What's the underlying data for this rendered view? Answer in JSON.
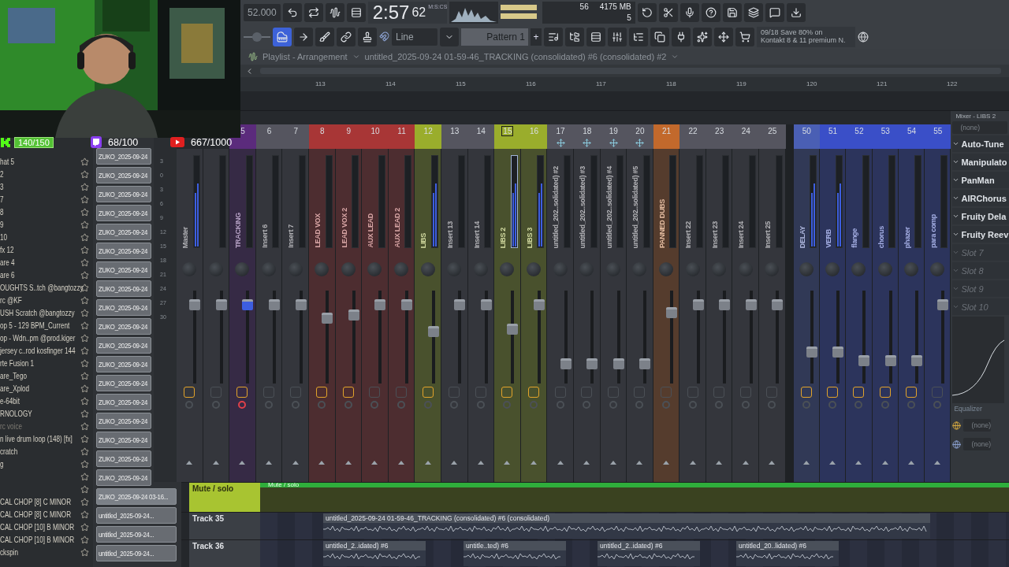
{
  "overlay": {
    "counters": [
      {
        "kind": "kick",
        "value": "140/150"
      },
      {
        "kind": "twitch",
        "value": "68/100"
      },
      {
        "kind": "youtube",
        "value": "667/1000"
      }
    ]
  },
  "toolbar": {
    "tempo": "52.000",
    "time": {
      "main": "2:57",
      "frac": "62",
      "unit": "M:S:CS"
    },
    "cpu": "56",
    "memory": "4175 MB",
    "voices": "5",
    "snap": "Line",
    "pattern": "Pattern 1",
    "pattern_add": "+",
    "news": {
      "date": "09/18",
      "line1": "Save 80% on",
      "line2": "Kontakt 8 & 11 premium N."
    },
    "tools": [
      {
        "selected": true
      },
      {
        "selected": false
      },
      {
        "selected": false
      },
      {
        "selected": false
      },
      {
        "selected": false
      }
    ]
  },
  "playlist": {
    "title": "Playlist - Arrangement",
    "arrangement": "untitled_2025-09-24 01-59-46_TRACKING (consolidated) #6 (consolidated) #2",
    "ruler": [
      "113",
      "114",
      "115",
      "116",
      "117",
      "118",
      "119",
      "120",
      "121",
      "122"
    ],
    "tracks": [
      {
        "name": "Mute / solo",
        "kind": "automation",
        "clips": [
          {
            "label": "Mute / solo"
          }
        ]
      },
      {
        "name": "Track 35",
        "kind": "audio",
        "clips": [
          {
            "label": "untitled_2025-09-24 01-59-46_TRACKING (consolidated) #6 (consolidated)"
          }
        ]
      },
      {
        "name": "Track 36",
        "kind": "audio",
        "clips": [
          {
            "label": "untitled_2..idated) #6"
          },
          {
            "label": "untitle..ted) #6"
          },
          {
            "label": "untitled_2..idated) #6"
          },
          {
            "label": "untitled_20..lidated) #6"
          }
        ]
      }
    ]
  },
  "browser": {
    "items": [
      {
        "kind": "file",
        "label": "hat 5",
        "dimmed": false
      },
      {
        "kind": "file",
        "label": "2",
        "dimmed": false
      },
      {
        "kind": "file",
        "label": "3",
        "dimmed": false
      },
      {
        "kind": "file",
        "label": "7",
        "dimmed": false
      },
      {
        "kind": "file",
        "label": "8",
        "dimmed": false
      },
      {
        "kind": "file",
        "label": "9",
        "dimmed": false
      },
      {
        "kind": "file",
        "label": "10",
        "dimmed": false
      },
      {
        "kind": "file",
        "label": "fx 12",
        "dimmed": false
      },
      {
        "kind": "file",
        "label": "are 4",
        "dimmed": false
      },
      {
        "kind": "file",
        "label": "are 6",
        "dimmed": false
      },
      {
        "kind": "file",
        "label": "OUGHTS S..tch @bangtozzy",
        "dimmed": false
      },
      {
        "kind": "file",
        "label": "rc @KF",
        "dimmed": false
      },
      {
        "kind": "file",
        "label": "USH Scratch @bangtozzy",
        "dimmed": false
      },
      {
        "kind": "file",
        "label": "op 5 - 129 BPM_Current",
        "dimmed": false
      },
      {
        "kind": "file",
        "label": "op - Wdn..pm @prod.kiger",
        "dimmed": false
      },
      {
        "kind": "file",
        "label": "jersey c..rod kosfinger 144",
        "dimmed": false
      },
      {
        "kind": "file",
        "label": "rte Fusion 1",
        "dimmed": false
      },
      {
        "kind": "file",
        "label": "are_Tego",
        "dimmed": false
      },
      {
        "kind": "file",
        "label": "are_Xplod",
        "dimmed": false
      },
      {
        "kind": "file",
        "label": "e-64bit",
        "dimmed": false
      },
      {
        "kind": "file",
        "label": "RNOLOGY",
        "dimmed": false
      },
      {
        "kind": "file",
        "label": "rc voice",
        "dimmed": true
      },
      {
        "kind": "file",
        "label": "n live drum loop (148) [fx]",
        "dimmed": false
      },
      {
        "kind": "file",
        "label": "cratch",
        "dimmed": false
      },
      {
        "kind": "file",
        "label": "g",
        "dimmed": false
      },
      {
        "kind": "blank"
      },
      {
        "kind": "blank"
      },
      {
        "kind": "file",
        "label": "CAL CHOP [8] C MINOR",
        "dimmed": false
      },
      {
        "kind": "file",
        "label": "CAL CHOP [8] C MINOR",
        "dimmed": false
      },
      {
        "kind": "file",
        "label": "CAL CHOP [10] B MINOR",
        "dimmed": false
      },
      {
        "kind": "file",
        "label": "CAL CHOP [10] B MINOR",
        "dimmed": false
      },
      {
        "kind": "file",
        "label": "ckspin",
        "dimmed": false
      }
    ]
  },
  "clips": [
    {
      "label": "ZUKO_2025-09-24",
      "selected": false,
      "kind": "short"
    },
    {
      "label": "ZUKO_2025-09-24",
      "selected": false,
      "kind": "short"
    },
    {
      "label": "ZUKO_2025-09-24",
      "selected": false,
      "kind": "short"
    },
    {
      "label": "ZUKO_2025-09-24",
      "selected": false,
      "kind": "short"
    },
    {
      "label": "ZUKO_2025-09-24",
      "selected": false,
      "kind": "short"
    },
    {
      "label": "ZUKO_2025-09-24",
      "selected": false,
      "kind": "short"
    },
    {
      "label": "ZUKO_2025-09-24",
      "selected": false,
      "kind": "short"
    },
    {
      "label": "ZUKO_2025-09-24",
      "selected": false,
      "kind": "short"
    },
    {
      "label": "ZUKO_2025-09-24",
      "selected": false,
      "kind": "short"
    },
    {
      "label": "ZUKO_2025-09-24",
      "selected": false,
      "kind": "short"
    },
    {
      "label": "ZUKO_2025-09-24",
      "selected": false,
      "kind": "short"
    },
    {
      "label": "ZUKO_2025-09-24",
      "selected": false,
      "kind": "short"
    },
    {
      "label": "ZUKO_2025-09-24",
      "selected": false,
      "kind": "short"
    },
    {
      "label": "ZUKO_2025-09-24",
      "selected": false,
      "kind": "short"
    },
    {
      "label": "ZUKO_2025-09-24",
      "selected": false,
      "kind": "short"
    },
    {
      "label": "ZUKO_2025-09-24",
      "selected": false,
      "kind": "short"
    },
    {
      "label": "ZUKO_2025-09-24",
      "selected": false,
      "kind": "short"
    },
    {
      "label": "ZUKO_2025-09-24",
      "selected": false,
      "kind": "short"
    },
    {
      "label": "ZUKO_2025-09-24 03-16...",
      "selected": true,
      "kind": "wide"
    },
    {
      "label": "untitled_2025-09-24...",
      "selected": false,
      "kind": "wide"
    },
    {
      "label": "untitled_2025-09-24...",
      "selected": false,
      "kind": "wide"
    },
    {
      "label": "untitled_2025-09-24...",
      "selected": false,
      "kind": "wide"
    }
  ],
  "mixer": {
    "title": "Mixer - LIBS 2",
    "scale": [
      "3",
      "0",
      "3",
      "6",
      "9",
      "12",
      "15",
      "18",
      "21",
      "24",
      "27",
      "30"
    ],
    "inserts": [
      {
        "name": "Master",
        "level": 0.89,
        "signal": true,
        "fx": true,
        "armed": false,
        "selected": false
      },
      {
        "level": 0.89,
        "signal": false,
        "fx": false,
        "armed": false,
        "selected": false
      },
      {
        "number": "5",
        "name": "TRACKING",
        "color": "#5b2b7c",
        "level": 0.89,
        "signal": false,
        "fx": true,
        "armed": true,
        "linked": false,
        "selected": false
      },
      {
        "number": "6",
        "name": "Insert 6",
        "color": "#55555f",
        "level": 0.89,
        "signal": false,
        "fx": false,
        "armed": false,
        "linked": false,
        "selected": false
      },
      {
        "number": "7",
        "name": "Insert 7",
        "color": "#55555f",
        "level": 0.89,
        "signal": false,
        "fx": false,
        "armed": false,
        "linked": false,
        "selected": false
      },
      {
        "number": "8",
        "name": "LEAD VOX",
        "color": "#a83636",
        "level": 0.73,
        "signal": false,
        "fx": true,
        "armed": false,
        "linked": false,
        "selected": false
      },
      {
        "number": "9",
        "name": "LEAD VOX 2",
        "color": "#a83636",
        "level": 0.77,
        "signal": false,
        "fx": true,
        "armed": false,
        "linked": false,
        "selected": false
      },
      {
        "number": "10",
        "name": "AUX LEAD",
        "color": "#a83636",
        "level": 0.89,
        "signal": false,
        "fx": false,
        "armed": false,
        "linked": false,
        "selected": false
      },
      {
        "number": "11",
        "name": "AUX LEAD 2",
        "color": "#a83636",
        "level": 0.89,
        "signal": false,
        "fx": false,
        "armed": false,
        "linked": false,
        "selected": false
      },
      {
        "number": "12",
        "name": "LIBS",
        "color": "#9aad2c",
        "level": 0.57,
        "signal": true,
        "fx": true,
        "armed": false,
        "linked": false,
        "selected": false
      },
      {
        "number": "13",
        "name": "Insert 13",
        "color": "#55555f",
        "level": 0.89,
        "signal": false,
        "fx": false,
        "armed": false,
        "linked": false,
        "selected": false
      },
      {
        "number": "14",
        "name": "Insert 14",
        "color": "#55555f",
        "level": 0.89,
        "signal": false,
        "fx": false,
        "armed": false,
        "linked": false,
        "selected": false
      },
      {
        "number": "15",
        "name": "LIBS 2",
        "color": "#9aad2c",
        "level": 0.6,
        "signal": true,
        "fx": true,
        "armed": false,
        "linked": false,
        "selected": true
      },
      {
        "number": "16",
        "name": "LIBS 3",
        "color": "#9aad2c",
        "level": 0.89,
        "signal": true,
        "fx": true,
        "armed": false,
        "linked": false,
        "selected": false
      },
      {
        "number": "17",
        "name": "untitled_202..solidated) #2",
        "color": "#55555f",
        "level": 0.17,
        "signal": false,
        "fx": false,
        "armed": false,
        "linked": true,
        "selected": false
      },
      {
        "number": "18",
        "name": "untitled_202..solidated) #3",
        "color": "#55555f",
        "level": 0.17,
        "signal": false,
        "fx": false,
        "armed": false,
        "linked": true,
        "selected": false
      },
      {
        "number": "19",
        "name": "untitled_202..solidated) #4",
        "color": "#55555f",
        "level": 0.17,
        "signal": false,
        "fx": false,
        "armed": false,
        "linked": true,
        "selected": false
      },
      {
        "number": "20",
        "name": "untitled_202..solidated) #5",
        "color": "#55555f",
        "level": 0.17,
        "signal": false,
        "fx": false,
        "armed": false,
        "linked": true,
        "selected": false
      },
      {
        "number": "21",
        "name": "PANNED DUBS",
        "color": "#c2692c",
        "level": 0.8,
        "signal": false,
        "fx": false,
        "armed": false,
        "linked": false,
        "selected": false
      },
      {
        "number": "22",
        "name": "Insert 22",
        "color": "#55555f",
        "level": 0.89,
        "signal": false,
        "fx": false,
        "armed": false,
        "linked": false,
        "selected": false
      },
      {
        "number": "23",
        "name": "Insert 23",
        "color": "#55555f",
        "level": 0.89,
        "signal": false,
        "fx": false,
        "armed": false,
        "linked": false,
        "selected": false
      },
      {
        "number": "24",
        "name": "Insert 24",
        "color": "#55555f",
        "level": 0.89,
        "signal": false,
        "fx": false,
        "armed": false,
        "linked": false,
        "selected": false
      },
      {
        "number": "25",
        "name": "Insert 25",
        "color": "#55555f",
        "level": 0.89,
        "signal": false,
        "fx": false,
        "armed": false,
        "linked": false,
        "selected": false
      }
    ],
    "sends": [
      {
        "number": "50",
        "name": "DELAY",
        "color": "#4a5fb4",
        "level": 0.32,
        "signal": true,
        "fx": true,
        "armed": false,
        "linked": false,
        "selected": false
      },
      {
        "number": "51",
        "name": "VERB",
        "color": "#3a4fc8",
        "level": 0.32,
        "signal": true,
        "fx": true,
        "armed": false,
        "linked": false,
        "selected": false
      },
      {
        "number": "52",
        "name": "flange",
        "color": "#3a4fc8",
        "level": 0.21,
        "signal": false,
        "fx": true,
        "armed": false,
        "linked": false,
        "selected": false
      },
      {
        "number": "53",
        "name": "chorus",
        "color": "#3a4fc8",
        "level": 0.21,
        "signal": false,
        "fx": true,
        "armed": false,
        "linked": false,
        "selected": false
      },
      {
        "number": "54",
        "name": "phazer",
        "color": "#3a4fc8",
        "level": 0.21,
        "signal": false,
        "fx": true,
        "armed": false,
        "linked": false,
        "selected": false
      },
      {
        "number": "55",
        "name": "para comp",
        "color": "#3a4fc8",
        "level": 0.89,
        "signal": false,
        "fx": false,
        "armed": false,
        "linked": false,
        "selected": false
      }
    ],
    "panel": {
      "input": "(none)",
      "slots": [
        {
          "label": "Auto-Tune",
          "kind": "effect"
        },
        {
          "label": "Manipulato",
          "kind": "effect"
        },
        {
          "label": "PanMan",
          "kind": "effect"
        },
        {
          "label": "AIRChorus",
          "kind": "effect"
        },
        {
          "label": "Fruity Dela",
          "kind": "effect"
        },
        {
          "label": "Fruity Reev",
          "kind": "effect"
        },
        {
          "label": "Slot 7",
          "kind": "empty"
        },
        {
          "label": "Slot 8",
          "kind": "empty"
        },
        {
          "label": "Slot 9",
          "kind": "empty"
        },
        {
          "label": "Slot 10",
          "kind": "empty"
        }
      ],
      "eq_label": "Equalizer",
      "outputs": [
        "(none)",
        "(none)"
      ]
    }
  }
}
